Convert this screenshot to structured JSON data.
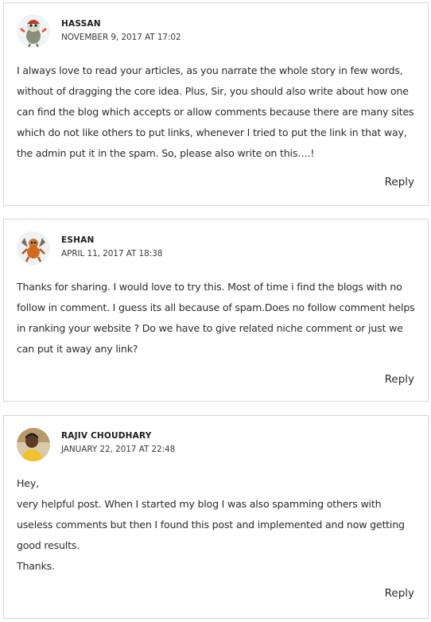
{
  "comments": [
    {
      "author": "HASSAN",
      "date": "NOVEMBER 9, 2017 AT 17:02",
      "avatar_icon": "turkey-monster-avatar",
      "paragraphs": [
        "I always love to read your articles, as you narrate the whole story in few words, without of dragging the core idea. Plus, Sir, you should also write about how one can find the blog which accepts or allow comments because there are many sites which do not like others to put links, whenever I tried to put the link in that way, the admin put it in the spam. So, please also write on this….!"
      ],
      "reply_label": "Reply"
    },
    {
      "author": "ESHAN",
      "date": "APRIL 11, 2017 AT 18:38",
      "avatar_icon": "winged-monster-avatar",
      "paragraphs": [
        "Thanks for sharing. I would love to try this. Most of time i find the blogs with no follow in comment. I guess its all because of spam.Does no follow comment helps in ranking your website ? Do we have to give related niche comment or just we can put it away any link?"
      ],
      "reply_label": "Reply"
    },
    {
      "author": "RAJIV CHOUDHARY",
      "date": "JANUARY 22, 2017 AT 22:48",
      "avatar_icon": "user-photo-avatar",
      "paragraphs": [
        "Hey,",
        "very helpful post. When I started my blog I was also spamming others with useless comments but then I found this post and implemented and now getting good results.",
        "Thanks."
      ],
      "reply_label": "Reply"
    }
  ]
}
